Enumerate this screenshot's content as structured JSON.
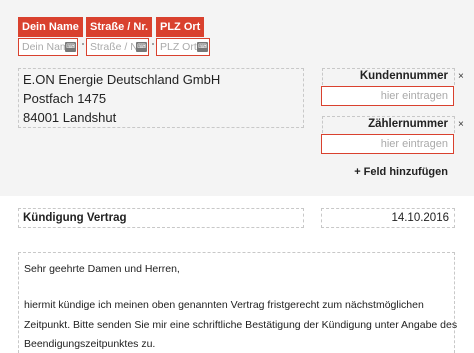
{
  "sender": {
    "name": {
      "label": "Dein Name",
      "placeholder": "Dein Name"
    },
    "street": {
      "label": "Straße / Nr.",
      "placeholder": "Straße / Nr."
    },
    "city": {
      "label": "PLZ Ort",
      "placeholder": "PLZ Ort"
    },
    "keyboard_icon": "keyboard-icon"
  },
  "recipient": {
    "lines": [
      "E.ON Energie Deutschland GmbH",
      "Postfach 1475",
      "84001 Landshut"
    ]
  },
  "fields": {
    "customer_number": {
      "label": "Kundennummer",
      "placeholder": "hier eintragen",
      "remove": "×"
    },
    "meter_number": {
      "label": "Zählernummer",
      "placeholder": "hier eintragen",
      "remove": "×"
    },
    "add_field": "+ Feld hinzufügen"
  },
  "subject": "Kündigung Vertrag",
  "date": "14.10.2016",
  "letter_body": {
    "greeting": "Sehr geehrte Damen und Herren,",
    "lines": [
      "hiermit kündige ich meinen oben genannten Vertrag fristgerecht zum nächstmöglichen",
      "Zeitpunkt. Bitte senden Sie mir eine schriftliche Bestätigung der Kündigung unter Angabe des",
      "Beendigungszeitpunktes zu."
    ]
  },
  "colors": {
    "accent": "#d9412e",
    "background_top": "#f4f4f4",
    "background_letter": "#ffffff"
  }
}
